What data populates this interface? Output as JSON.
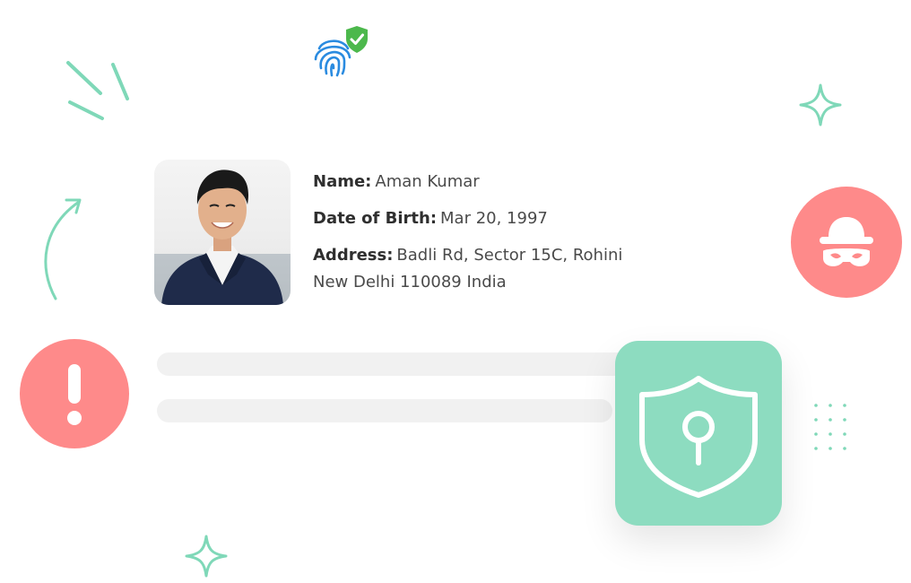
{
  "profile": {
    "name_label": "Name:",
    "name_value": "Aman Kumar",
    "dob_label": "Date of Birth:",
    "dob_value": "Mar 20, 1997",
    "address_label": "Address:",
    "address_line1": "Badli Rd, Sector 15C, Rohini",
    "address_line2": "New Delhi 110089 India"
  },
  "icons": {
    "fingerprint": "fingerprint-icon",
    "verified": "verified-shield-icon",
    "alert": "alert-icon",
    "spy": "spy-icon",
    "shield_lock": "shield-lock-icon"
  },
  "colors": {
    "accent_green": "#8ddcc0",
    "alert_red": "#fe8a8a",
    "fingerprint_blue": "#2a8be0",
    "check_green": "#4cb84c"
  }
}
